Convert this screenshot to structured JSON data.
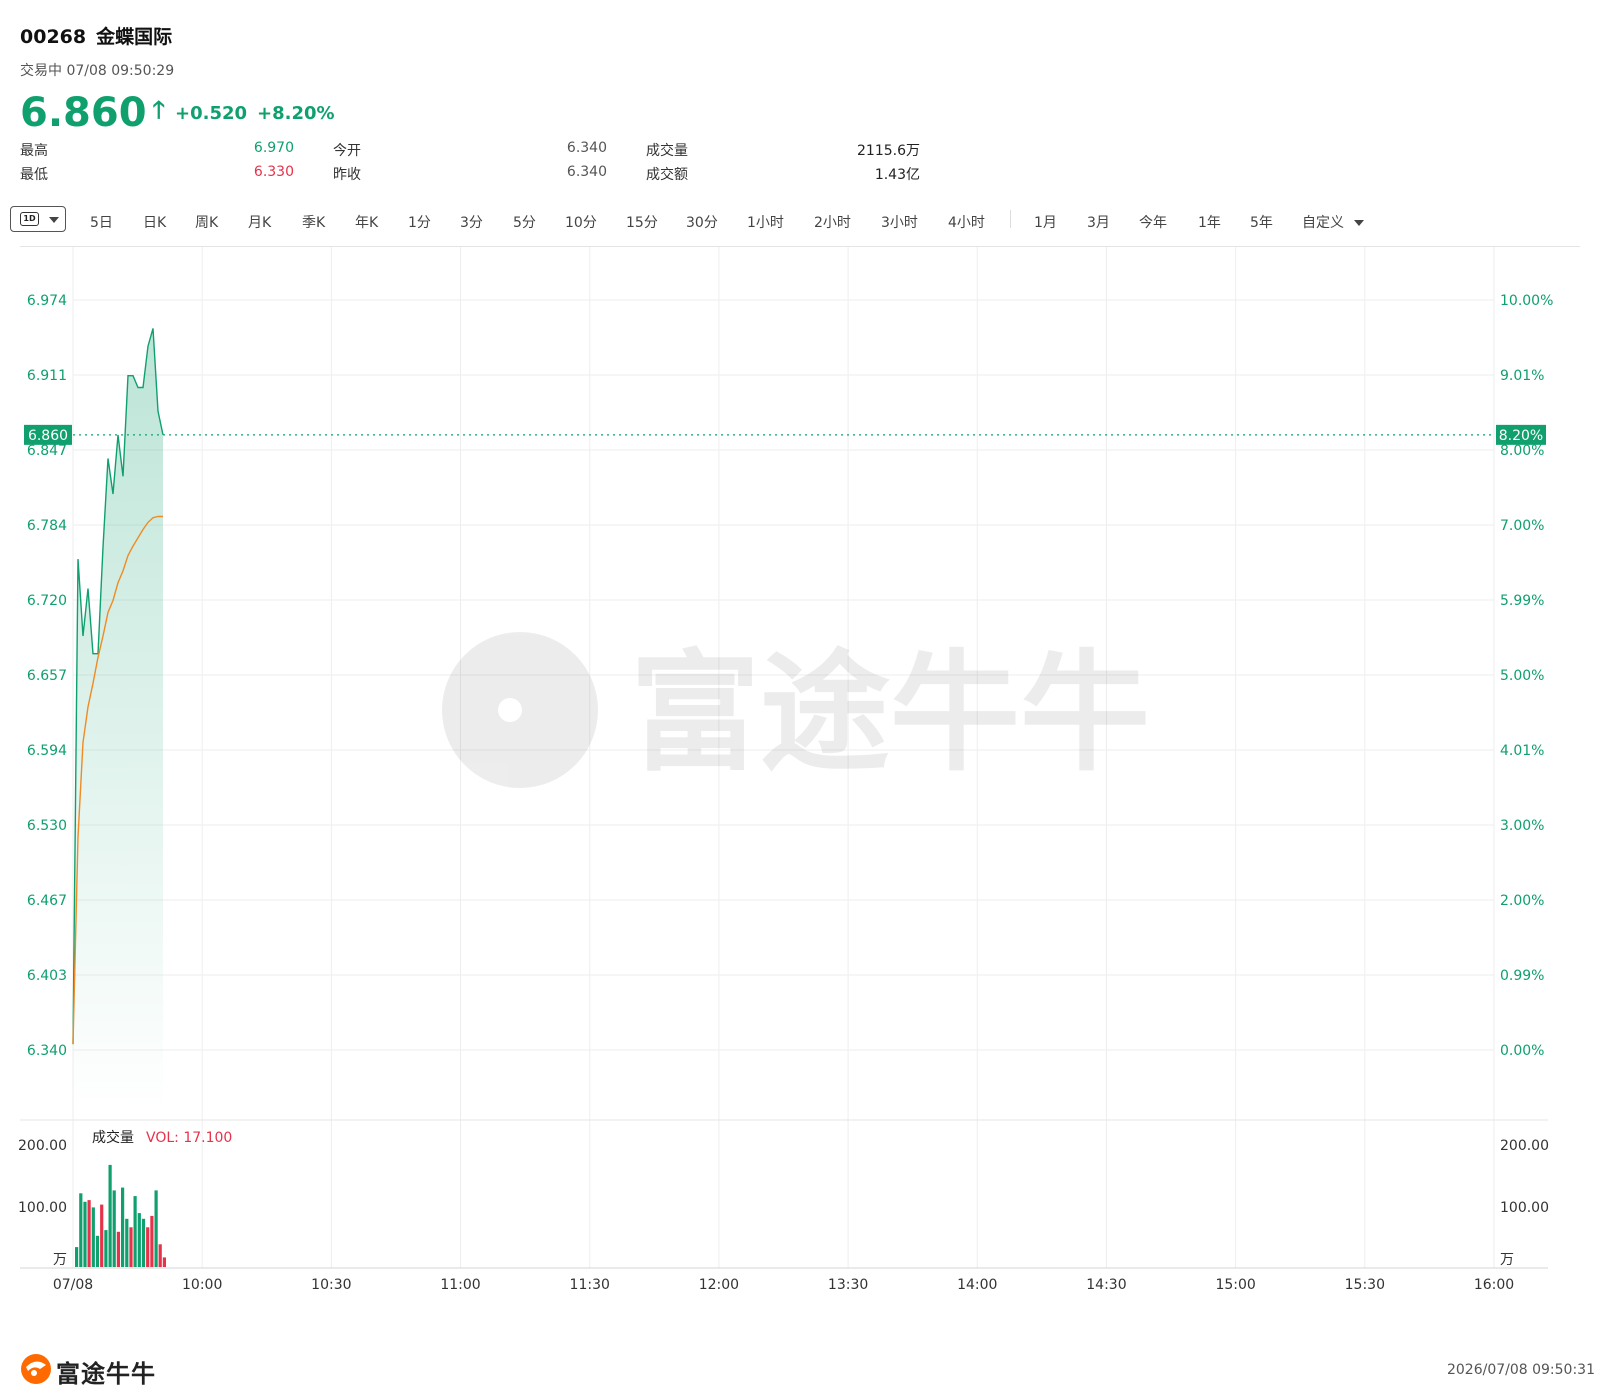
{
  "header": {
    "code": "00268",
    "name": "金蝶国际",
    "status": "交易中 07/08 09:50:29",
    "price": "6.860",
    "change": "+0.520",
    "change_pct": "+8.20%"
  },
  "stats": [
    {
      "label": "最高",
      "value": "6.970",
      "color": "#0fa06e"
    },
    {
      "label": "最低",
      "value": "6.330",
      "color": "#e5334b"
    },
    {
      "label": "今开",
      "value": "6.340",
      "color": "#555555"
    },
    {
      "label": "昨收",
      "value": "6.340",
      "color": "#555555"
    },
    {
      "label": "成交量",
      "value": "2115.6万",
      "color": "#222222"
    },
    {
      "label": "成交额",
      "value": "1.43亿",
      "color": "#222222"
    }
  ],
  "tabs": {
    "active": "1D",
    "items": [
      "5日",
      "日K",
      "周K",
      "月K",
      "季K",
      "年K",
      "1分",
      "3分",
      "5分",
      "10分",
      "15分",
      "30分",
      "1小时",
      "2小时",
      "3小时",
      "4小时",
      "1月",
      "3月",
      "今年",
      "1年",
      "5年",
      "自定义"
    ]
  },
  "colors": {
    "up": "#0fa06e",
    "down": "#e5334b",
    "avg_line": "#f08a24",
    "grid": "#eeeeee"
  },
  "watermark": "富途牛牛",
  "footer": {
    "brand": "富途牛牛",
    "timestamp": "2026/07/08 09:50:31"
  },
  "chart_data": [
    {
      "type": "line",
      "name": "intraday",
      "x_labels": [
        "07/08",
        "10:00",
        "10:30",
        "11:00",
        "11:30",
        "12:00",
        "13:30",
        "14:00",
        "14:30",
        "15:00",
        "15:30",
        "16:00"
      ],
      "y_left_ticks": [
        "6.974",
        "6.911",
        "6.847",
        "6.784",
        "6.720",
        "6.657",
        "6.594",
        "6.530",
        "6.467",
        "6.403",
        "6.340"
      ],
      "y_right_ticks": [
        "10.00%",
        "9.01%",
        "8.00%",
        "7.00%",
        "5.99%",
        "5.00%",
        "4.01%",
        "3.00%",
        "2.00%",
        "0.99%",
        "0.00%"
      ],
      "ylim": [
        6.34,
        6.974
      ],
      "prev_close": 6.34,
      "last_price": "6.860",
      "last_pct": "8.20%",
      "price_series": [
        6.345,
        6.755,
        6.69,
        6.73,
        6.675,
        6.675,
        6.765,
        6.84,
        6.81,
        6.86,
        6.825,
        6.91,
        6.91,
        6.9,
        6.9,
        6.935,
        6.95,
        6.88,
        6.86
      ],
      "avg_series": [
        6.345,
        6.52,
        6.6,
        6.63,
        6.65,
        6.672,
        6.69,
        6.71,
        6.72,
        6.735,
        6.745,
        6.758,
        6.766,
        6.773,
        6.78,
        6.786,
        6.79,
        6.791,
        6.791
      ]
    },
    {
      "type": "bar",
      "name": "volume",
      "title": "成交量",
      "legend": "VOL: 17.100",
      "unit": "万",
      "y_ticks": [
        "200.00",
        "100.00"
      ],
      "ylim": [
        0,
        230
      ],
      "values": [
        35,
        130,
        115,
        118,
        105,
        55,
        110,
        65,
        180,
        135,
        62,
        140,
        85,
        70,
        125,
        95,
        85,
        70,
        90,
        135,
        40,
        17
      ],
      "up": [
        true,
        true,
        true,
        false,
        true,
        true,
        false,
        true,
        true,
        true,
        false,
        true,
        true,
        false,
        true,
        true,
        true,
        false,
        false,
        true,
        false,
        false
      ]
    }
  ]
}
